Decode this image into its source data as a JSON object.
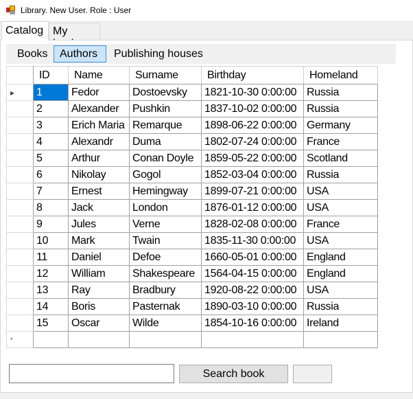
{
  "window": {
    "title": "Library. New User. Role : User",
    "icon": "app-icon"
  },
  "tabs": [
    {
      "label": "Catalog",
      "selected": true
    },
    {
      "label": "My books",
      "selected": false
    }
  ],
  "subtabs": [
    {
      "label": "Books",
      "selected": false
    },
    {
      "label": "Authors",
      "selected": true
    },
    {
      "label": "Publishing houses",
      "selected": false
    }
  ],
  "grid": {
    "columns": [
      "ID",
      "Name",
      "Surname",
      "Birthday",
      "Homeland"
    ],
    "current_row_marker": "▸",
    "new_row_marker": "*",
    "rows": [
      [
        "1",
        "Fedor",
        "Dostoevsky",
        "1821-10-30 0:00:00",
        "Russia"
      ],
      [
        "2",
        "Alexander",
        "Pushkin",
        "1837-10-02 0:00:00",
        "Russia"
      ],
      [
        "3",
        "Erich Maria",
        "Remarque",
        "1898-06-22 0:00:00",
        "Germany"
      ],
      [
        "4",
        "Alexandr",
        "Duma",
        "1802-07-24 0:00:00",
        "France"
      ],
      [
        "5",
        "Arthur",
        "Conan Doyle",
        "1859-05-22 0:00:00",
        "Scotland"
      ],
      [
        "6",
        "Nikolay",
        "Gogol",
        "1852-03-04 0:00:00",
        "Russia"
      ],
      [
        "7",
        "Ernest",
        "Hemingway",
        "1899-07-21 0:00:00",
        "USA"
      ],
      [
        "8",
        "Jack",
        "London",
        "1876-01-12 0:00:00",
        "USA"
      ],
      [
        "9",
        "Jules",
        "Verne",
        "1828-02-08 0:00:00",
        "France"
      ],
      [
        "10",
        "Mark",
        "Twain",
        "1835-11-30 0:00:00",
        "USA"
      ],
      [
        "11",
        "Daniel",
        "Defoe",
        "1660-05-01 0:00:00",
        "England"
      ],
      [
        "12",
        "William",
        "Shakespeare",
        "1564-04-15 0:00:00",
        "England"
      ],
      [
        "13",
        "Ray",
        "Bradbury",
        "1920-08-22 0:00:00",
        "USA"
      ],
      [
        "14",
        "Boris",
        "Pasternak",
        "1890-03-10 0:00:00",
        "Russia"
      ],
      [
        "15",
        "Oscar",
        "Wilde",
        "1854-10-16 0:00:00",
        "Ireland"
      ]
    ]
  },
  "search": {
    "value": "",
    "button_label": "Search book",
    "extra_button_label": ""
  },
  "colors": {
    "selection": "#0078d7",
    "subtab_selected": "#cce4f7"
  }
}
